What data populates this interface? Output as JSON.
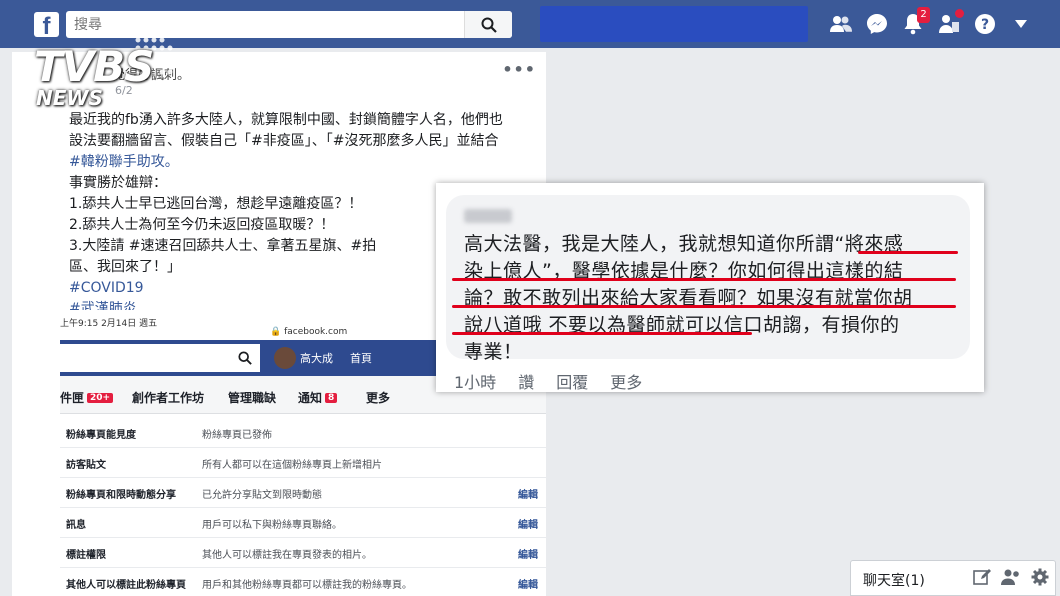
{
  "topbar": {
    "logo": "f",
    "search_placeholder": "搜尋",
    "notification_count": "2"
  },
  "post": {
    "header": "覺得好諷刺。",
    "date": "6/2",
    "lines": [
      "最近我的fb湧入許多大陸人，就算限制中國、封鎖簡體字人名，他們也",
      "設法要翻牆留言、假裝自己「#非疫區」、「#沒死那麼多人民」並結合",
      "#韓粉聯手助攻。",
      "事實勝於雄辯：",
      "1.舔共人士早已逃回台灣，想趁早遠離疫區？！",
      "2.舔共人士為何至今仍未返回疫區取暖？！",
      "3.大陸請 #速速召回舔共人士、拿著五星旗、#拍",
      "區、我回來了！」",
      "#COVID19",
      "#武漢肺炎"
    ]
  },
  "watermark": {
    "big": "TVBS",
    "small": "NEWS"
  },
  "phone": {
    "status": "上午9:15  2月14日 週五",
    "url": "facebook.com",
    "user": "高大成",
    "home": "首頁",
    "tabs": [
      {
        "label": "件匣",
        "badge": "20+"
      },
      {
        "label": "創作者工作坊",
        "badge": ""
      },
      {
        "label": "管理職缺",
        "badge": ""
      },
      {
        "label": "通知",
        "badge": "8"
      },
      {
        "label": "更多",
        "badge": ""
      }
    ],
    "rows": [
      {
        "key": "粉絲專頁能見度",
        "value": "粉絲專頁已發佈",
        "edit": ""
      },
      {
        "key": "訪客貼文",
        "value": "所有人都可以在這個粉絲專頁上新增相片",
        "edit": ""
      },
      {
        "key": "粉絲專頁和限時動態分享",
        "value": "已允許分享貼文到限時動態",
        "edit": "編輯"
      },
      {
        "key": "訊息",
        "value": "用戶可以私下與粉絲專頁聯絡。",
        "edit": "編輯"
      },
      {
        "key": "標註權限",
        "value": "其他人可以標註我在專頁發表的相片。",
        "edit": "編輯"
      },
      {
        "key": "其他人可以標註此粉絲專頁",
        "value": "用戶和其他粉絲專頁都可以標註我的粉絲專頁。",
        "edit": "編輯"
      }
    ]
  },
  "comment": {
    "lines": [
      "高大法醫，我是大陸人，我就想知道你所謂“將來感",
      "染上億人”，醫學依據是什麼？你如何得出這樣的結",
      "論？敢不敢列出來給大家看看啊？如果沒有就當你胡",
      "說八道哦 不要以為醫師就可以信口胡謅，有損你的",
      "專業！"
    ],
    "actions": [
      "1小時",
      "讚",
      "回覆",
      "更多"
    ]
  },
  "chat": {
    "label": "聊天室(1)"
  },
  "colors": {
    "brand": "#3b5998",
    "underline": "#e0001b",
    "link": "#365899"
  }
}
